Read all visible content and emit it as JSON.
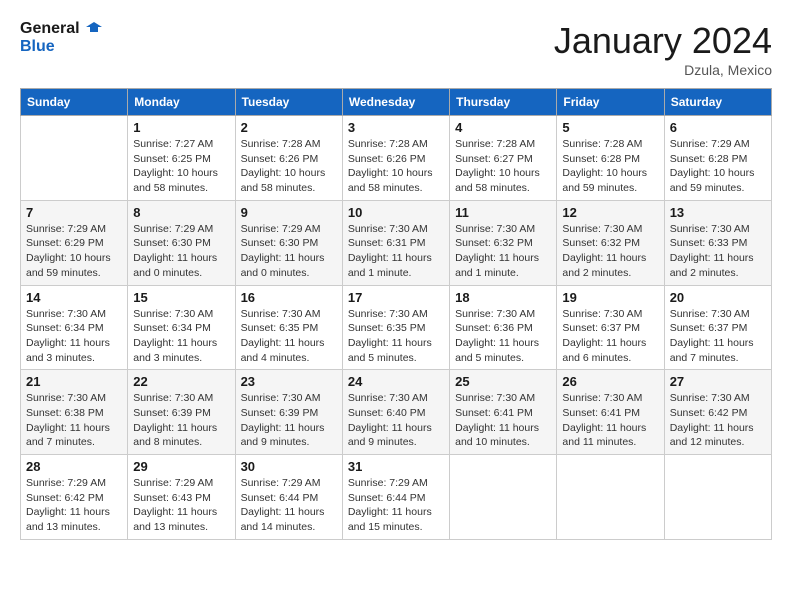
{
  "header": {
    "logo_line1": "General",
    "logo_line2": "Blue",
    "month": "January 2024",
    "location": "Dzula, Mexico"
  },
  "weekdays": [
    "Sunday",
    "Monday",
    "Tuesday",
    "Wednesday",
    "Thursday",
    "Friday",
    "Saturday"
  ],
  "weeks": [
    [
      {
        "day": "",
        "info": ""
      },
      {
        "day": "1",
        "info": "Sunrise: 7:27 AM\nSunset: 6:25 PM\nDaylight: 10 hours\nand 58 minutes."
      },
      {
        "day": "2",
        "info": "Sunrise: 7:28 AM\nSunset: 6:26 PM\nDaylight: 10 hours\nand 58 minutes."
      },
      {
        "day": "3",
        "info": "Sunrise: 7:28 AM\nSunset: 6:26 PM\nDaylight: 10 hours\nand 58 minutes."
      },
      {
        "day": "4",
        "info": "Sunrise: 7:28 AM\nSunset: 6:27 PM\nDaylight: 10 hours\nand 58 minutes."
      },
      {
        "day": "5",
        "info": "Sunrise: 7:28 AM\nSunset: 6:28 PM\nDaylight: 10 hours\nand 59 minutes."
      },
      {
        "day": "6",
        "info": "Sunrise: 7:29 AM\nSunset: 6:28 PM\nDaylight: 10 hours\nand 59 minutes."
      }
    ],
    [
      {
        "day": "7",
        "info": "Sunrise: 7:29 AM\nSunset: 6:29 PM\nDaylight: 10 hours\nand 59 minutes."
      },
      {
        "day": "8",
        "info": "Sunrise: 7:29 AM\nSunset: 6:30 PM\nDaylight: 11 hours\nand 0 minutes."
      },
      {
        "day": "9",
        "info": "Sunrise: 7:29 AM\nSunset: 6:30 PM\nDaylight: 11 hours\nand 0 minutes."
      },
      {
        "day": "10",
        "info": "Sunrise: 7:30 AM\nSunset: 6:31 PM\nDaylight: 11 hours\nand 1 minute."
      },
      {
        "day": "11",
        "info": "Sunrise: 7:30 AM\nSunset: 6:32 PM\nDaylight: 11 hours\nand 1 minute."
      },
      {
        "day": "12",
        "info": "Sunrise: 7:30 AM\nSunset: 6:32 PM\nDaylight: 11 hours\nand 2 minutes."
      },
      {
        "day": "13",
        "info": "Sunrise: 7:30 AM\nSunset: 6:33 PM\nDaylight: 11 hours\nand 2 minutes."
      }
    ],
    [
      {
        "day": "14",
        "info": "Sunrise: 7:30 AM\nSunset: 6:34 PM\nDaylight: 11 hours\nand 3 minutes."
      },
      {
        "day": "15",
        "info": "Sunrise: 7:30 AM\nSunset: 6:34 PM\nDaylight: 11 hours\nand 3 minutes."
      },
      {
        "day": "16",
        "info": "Sunrise: 7:30 AM\nSunset: 6:35 PM\nDaylight: 11 hours\nand 4 minutes."
      },
      {
        "day": "17",
        "info": "Sunrise: 7:30 AM\nSunset: 6:35 PM\nDaylight: 11 hours\nand 5 minutes."
      },
      {
        "day": "18",
        "info": "Sunrise: 7:30 AM\nSunset: 6:36 PM\nDaylight: 11 hours\nand 5 minutes."
      },
      {
        "day": "19",
        "info": "Sunrise: 7:30 AM\nSunset: 6:37 PM\nDaylight: 11 hours\nand 6 minutes."
      },
      {
        "day": "20",
        "info": "Sunrise: 7:30 AM\nSunset: 6:37 PM\nDaylight: 11 hours\nand 7 minutes."
      }
    ],
    [
      {
        "day": "21",
        "info": "Sunrise: 7:30 AM\nSunset: 6:38 PM\nDaylight: 11 hours\nand 7 minutes."
      },
      {
        "day": "22",
        "info": "Sunrise: 7:30 AM\nSunset: 6:39 PM\nDaylight: 11 hours\nand 8 minutes."
      },
      {
        "day": "23",
        "info": "Sunrise: 7:30 AM\nSunset: 6:39 PM\nDaylight: 11 hours\nand 9 minutes."
      },
      {
        "day": "24",
        "info": "Sunrise: 7:30 AM\nSunset: 6:40 PM\nDaylight: 11 hours\nand 9 minutes."
      },
      {
        "day": "25",
        "info": "Sunrise: 7:30 AM\nSunset: 6:41 PM\nDaylight: 11 hours\nand 10 minutes."
      },
      {
        "day": "26",
        "info": "Sunrise: 7:30 AM\nSunset: 6:41 PM\nDaylight: 11 hours\nand 11 minutes."
      },
      {
        "day": "27",
        "info": "Sunrise: 7:30 AM\nSunset: 6:42 PM\nDaylight: 11 hours\nand 12 minutes."
      }
    ],
    [
      {
        "day": "28",
        "info": "Sunrise: 7:29 AM\nSunset: 6:42 PM\nDaylight: 11 hours\nand 13 minutes."
      },
      {
        "day": "29",
        "info": "Sunrise: 7:29 AM\nSunset: 6:43 PM\nDaylight: 11 hours\nand 13 minutes."
      },
      {
        "day": "30",
        "info": "Sunrise: 7:29 AM\nSunset: 6:44 PM\nDaylight: 11 hours\nand 14 minutes."
      },
      {
        "day": "31",
        "info": "Sunrise: 7:29 AM\nSunset: 6:44 PM\nDaylight: 11 hours\nand 15 minutes."
      },
      {
        "day": "",
        "info": ""
      },
      {
        "day": "",
        "info": ""
      },
      {
        "day": "",
        "info": ""
      }
    ]
  ]
}
